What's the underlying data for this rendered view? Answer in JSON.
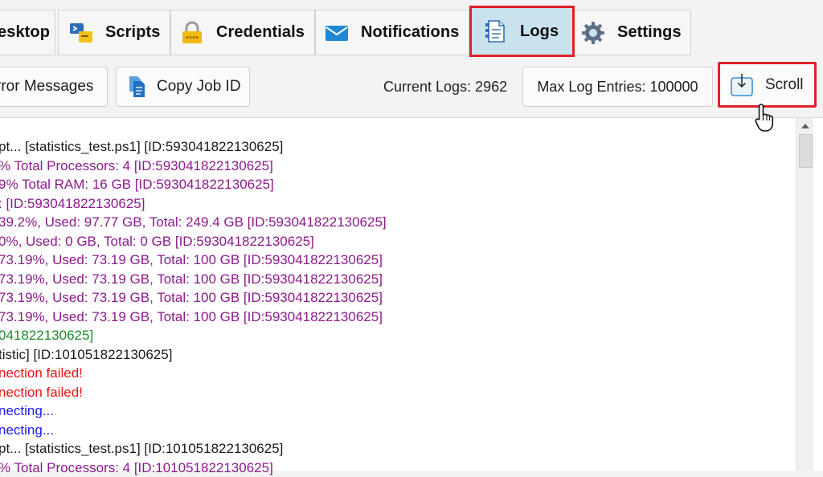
{
  "tabs": [
    {
      "label": "esktop"
    },
    {
      "label": "Scripts"
    },
    {
      "label": "Credentials"
    },
    {
      "label": "Notifications"
    },
    {
      "label": "Logs",
      "active": true
    },
    {
      "label": "Settings"
    }
  ],
  "toolbar": {
    "errors_label": "rror Messages",
    "copy_label": "Copy Job ID",
    "current_logs": "Current Logs: 2962",
    "max_entries_label": "Max Log Entries: 100000",
    "scroll_label": "Scroll"
  },
  "colors": {
    "default": "#1a1a1a",
    "purple": "#8b1a8b",
    "green": "#1f8a2a",
    "red": "#ee1111",
    "blue": "#1a1aff",
    "highlight": "#e0202a",
    "active_tab": "#c9e3ee"
  },
  "logs": [
    {
      "text": "pt... [statistics_test.ps1] [ID:593041822130625]",
      "color": "default"
    },
    {
      "text": "% Total Processors: 4 [ID:593041822130625]",
      "color": "purple"
    },
    {
      "text": "9% Total RAM: 16 GB [ID:593041822130625]",
      "color": "purple"
    },
    {
      "text": ": [ID:593041822130625]",
      "color": "purple"
    },
    {
      "text": "39.2%, Used: 97.77 GB, Total: 249.4 GB [ID:593041822130625]",
      "color": "purple"
    },
    {
      "text": "0%, Used: 0 GB, Total: 0 GB [ID:593041822130625]",
      "color": "purple"
    },
    {
      "text": "73.19%, Used: 73.19 GB, Total: 100 GB [ID:593041822130625]",
      "color": "purple"
    },
    {
      "text": "73.19%, Used: 73.19 GB, Total: 100 GB [ID:593041822130625]",
      "color": "purple"
    },
    {
      "text": "73.19%, Used: 73.19 GB, Total: 100 GB [ID:593041822130625]",
      "color": "purple"
    },
    {
      "text": "73.19%, Used: 73.19 GB, Total: 100 GB [ID:593041822130625]",
      "color": "purple"
    },
    {
      "text": "041822130625]",
      "color": "green"
    },
    {
      "text": "tistic] [ID:101051822130625]",
      "color": "default"
    },
    {
      "text": "nection failed!",
      "color": "red"
    },
    {
      "text": "nection failed!",
      "color": "red"
    },
    {
      "text": "necting...",
      "color": "blue"
    },
    {
      "text": "necting...",
      "color": "blue"
    },
    {
      "text": "pt... [statistics_test.ps1] [ID:101051822130625]",
      "color": "default"
    },
    {
      "text": "% Total Processors: 4 [ID:101051822130625]",
      "color": "purple"
    }
  ]
}
